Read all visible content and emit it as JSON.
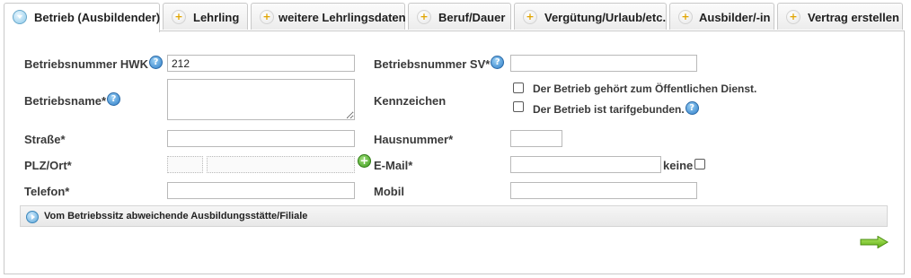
{
  "tabs": [
    {
      "label": "Betrieb (Ausbildender)",
      "icon": "collapse-icon",
      "active": true
    },
    {
      "label": "Lehrling",
      "icon": "plus-icon"
    },
    {
      "label": "weitere Lehrlingsdaten",
      "icon": "plus-icon"
    },
    {
      "label": "Beruf/Dauer",
      "icon": "plus-icon"
    },
    {
      "label": "Vergütung/Urlaub/etc.",
      "icon": "plus-icon"
    },
    {
      "label": "Ausbilder/-in",
      "icon": "plus-icon"
    },
    {
      "label": "Vertrag erstellen",
      "icon": "plus-icon"
    }
  ],
  "form": {
    "betriebsnummer_hwk_label": "Betriebsnummer HWK",
    "betriebsnummer_hwk_value": "212",
    "betriebsnummer_sv_label": "Betriebsnummer SV*",
    "betriebsnummer_sv_value": "",
    "betriebsname_label": "Betriebsname*",
    "betriebsname_value": "",
    "kennzeichen_label": "Kennzeichen",
    "oeffentlicher_dienst_label": "Der Betrieb gehört zum Öffentlichen Dienst.",
    "tarifgebunden_label": "Der Betrieb ist tarifgebunden.",
    "strasse_label": "Straße*",
    "strasse_value": "",
    "hausnummer_label": "Hausnummer*",
    "hausnummer_value": "",
    "plz_ort_label": "PLZ/Ort*",
    "plz_value": "",
    "ort_value": "",
    "email_label": "E-Mail*",
    "email_value": "",
    "keine_label": "keine",
    "telefon_label": "Telefon*",
    "telefon_value": "",
    "mobil_label": "Mobil",
    "mobil_value": ""
  },
  "help_icon_glyph": "?",
  "tab_plus_glyph": "+",
  "add_glyph": "+",
  "branch_section": {
    "label": "Vom Betriebssitz abweichende Ausbildungsstätte/Filiale",
    "icon": "expand-arrow-icon"
  },
  "colors": {
    "accent_green": "#6cc21a",
    "help_blue": "#2f7ec8"
  }
}
